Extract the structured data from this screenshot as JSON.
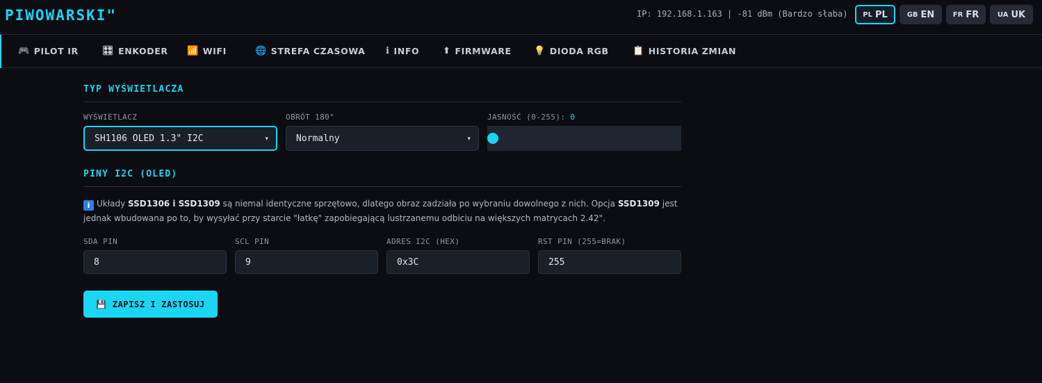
{
  "header": {
    "brand": "PIWOWARSKI\"",
    "status": "IP: 192.168.1.163 | -81 dBm (Bardzo słaba)",
    "languages": [
      {
        "code": "PL",
        "label": "PL",
        "active": true
      },
      {
        "code": "GB",
        "label": "EN",
        "active": false
      },
      {
        "code": "FR",
        "label": "FR",
        "active": false
      },
      {
        "code": "UA",
        "label": "UK",
        "active": false
      }
    ]
  },
  "tabs": [
    {
      "icon": "🎮",
      "icon_name": "gamepad-icon",
      "label": "PILOT IR"
    },
    {
      "icon": "🎛",
      "icon_name": "encoder-icon",
      "label": "ENKODER"
    },
    {
      "icon": "📶",
      "icon_name": "wifi-signal-icon",
      "label": "WIFI"
    },
    {
      "icon": "🌐",
      "icon_name": "globe-icon",
      "label": "STREFA CZASOWA"
    },
    {
      "icon": "ℹ",
      "icon_name": "info-icon",
      "label": "INFO"
    },
    {
      "icon": "⬆",
      "icon_name": "upload-arrow-icon",
      "label": "FIRMWARE"
    },
    {
      "icon": "💡",
      "icon_name": "light-bulb-icon",
      "label": "DIODA RGB"
    },
    {
      "icon": "📋",
      "icon_name": "clipboard-icon",
      "label": "HISTORIA ZMIAN"
    }
  ],
  "display_section": {
    "title": "TYP WYŚWIETLACZA",
    "display_label": "WYŚWIETLACZ",
    "display_value": "SH1106 OLED 1.3\" I2C",
    "rotation_label": "OBRÓT 180°",
    "rotation_value": "Normalny",
    "brightness_label": "JASNOŚĆ (0-255):",
    "brightness_value": "0",
    "brightness_level": 0
  },
  "i2c_section": {
    "title": "PINY I2C (OLED)",
    "note_prefix": "Układy ",
    "note_bold1": "SSD1306 i SSD1309",
    "note_mid": " są niemal identyczne sprzętowo, dlatego obraz zadziała po wybraniu dowolnego z nich. Opcja ",
    "note_bold2": "SSD1309",
    "note_suffix": " jest jednak wbudowana po to, by wysyłać przy starcie \"łatkę\" zapobiegającą lustrzanemu odbiciu na większych matrycach 2.42\".",
    "fields": [
      {
        "label": "SDA PIN",
        "value": "8"
      },
      {
        "label": "SCL PIN",
        "value": "9"
      },
      {
        "label": "ADRES I2C (HEX)",
        "value": "0x3C"
      },
      {
        "label": "RST PIN (255=BRAK)",
        "value": "255"
      }
    ]
  },
  "save_button": {
    "icon": "💾",
    "label": "ZAPISZ I ZASTOSUJ"
  },
  "colors": {
    "accent": "#19d6f2",
    "background": "#0b0d12"
  }
}
